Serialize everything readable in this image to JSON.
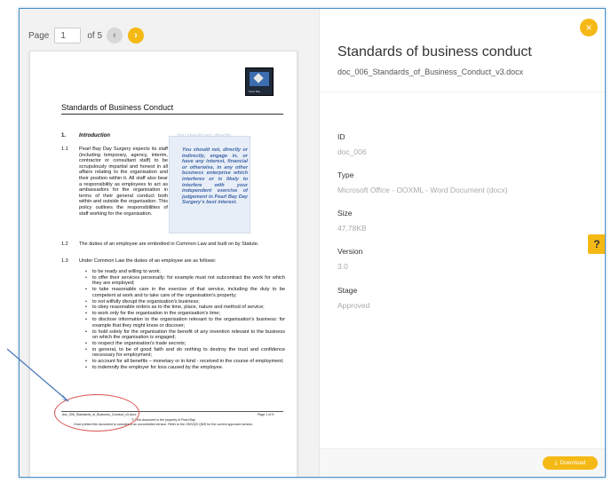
{
  "viewer": {
    "pager": {
      "page_label": "Page",
      "current_page": "1",
      "of_label": "of 5"
    },
    "nav": {
      "prev_icon": "‹",
      "next_icon": "›"
    },
    "document": {
      "logo_text": "Pearl Bay",
      "title": "Standards of Business Conduct",
      "section_number": "1.",
      "section_title": "Introduction",
      "p1_1_num": "1.1",
      "p1_1": "Pearl Bay Day Surgery expects its staff (including temporary, agency, interim, contractor or consultant staff) to be scrupulously impartial and honest in all affairs relating to the organisation and their position within it. All staff also bear a responsibility as employees to act as ambassadors for the organisation in terms of their general conduct both within and outside the organisation. This policy outlines the responsibilities of staff working for the organisation.",
      "pullquote_ghost": "You should not, directly",
      "pullquote": "You should not, directly or indirectly, engage in, or have any interest, financial or otherwise, in any other business enterprise which interferes or is likely to interfere with your independent exercise of judgement in Pearl Bay Day Surgery's best interest.",
      "p1_2_num": "1.2",
      "p1_2": "The duties of an employee are embodied in Common Law and built on by Statute.",
      "p1_3_num": "1.3",
      "p1_3": "Under Common Law the duties of an employee are as follows:",
      "bullets": [
        "to be ready and willing to work;",
        "to offer their services personally: for example must not subcontract the work for which they are employed;",
        "to take reasonable care in the exercise of that service, including the duty to be competent at work and to take care of the organisation's property;",
        "to not wilfully disrupt the organisation's business;",
        "to obey reasonable orders as to the time, place, nature and method of service;",
        "to work only for the organisation in the organisation's time;",
        "to disclose information to the organisation relevant to the organisation's business: for example that they might know or discover;",
        "to hold solely for the organisation the benefit of any invention relevant to the business on which the organisation is engaged;",
        "to respect the organisation's trade secrets;",
        "in general, to be of good faith and do nothing to destroy the trust and confidence necessary for employment;",
        "to account for all benefits – monetary or in kind - received in the course of employment;",
        "to indemnify the employer for loss caused by the employee."
      ],
      "footer_file": "doc_006_Standards_of_Business_Conduct_v3.docx",
      "footer_page": "Page 1 of 5",
      "footer_note1": "© This document is the property of Pearl Bay",
      "footer_note2": "Once printed this document is considered an uncontrolled version. Refer to the ODS/QS QMS for the current approved version."
    }
  },
  "details": {
    "close_icon": "×",
    "title": "Standards of business conduct",
    "filename": "doc_006_Standards_of_Business_Conduct_v3.docx",
    "fields": [
      {
        "label": "ID",
        "value": "doc_006"
      },
      {
        "label": "Type",
        "value": "Microsoft Office - OOXML - Word Document (docx)"
      },
      {
        "label": "Size",
        "value": "47,78KB"
      },
      {
        "label": "Version",
        "value": "3.0"
      },
      {
        "label": "Stage",
        "value": "Approved"
      }
    ],
    "help_label": "?",
    "download_icon": "⤓",
    "download_label": "Download"
  },
  "colors": {
    "accent": "#f5b915",
    "annotation": "#d9534f",
    "frame": "#4a90c8",
    "pullquote_text": "#3d64a8"
  }
}
